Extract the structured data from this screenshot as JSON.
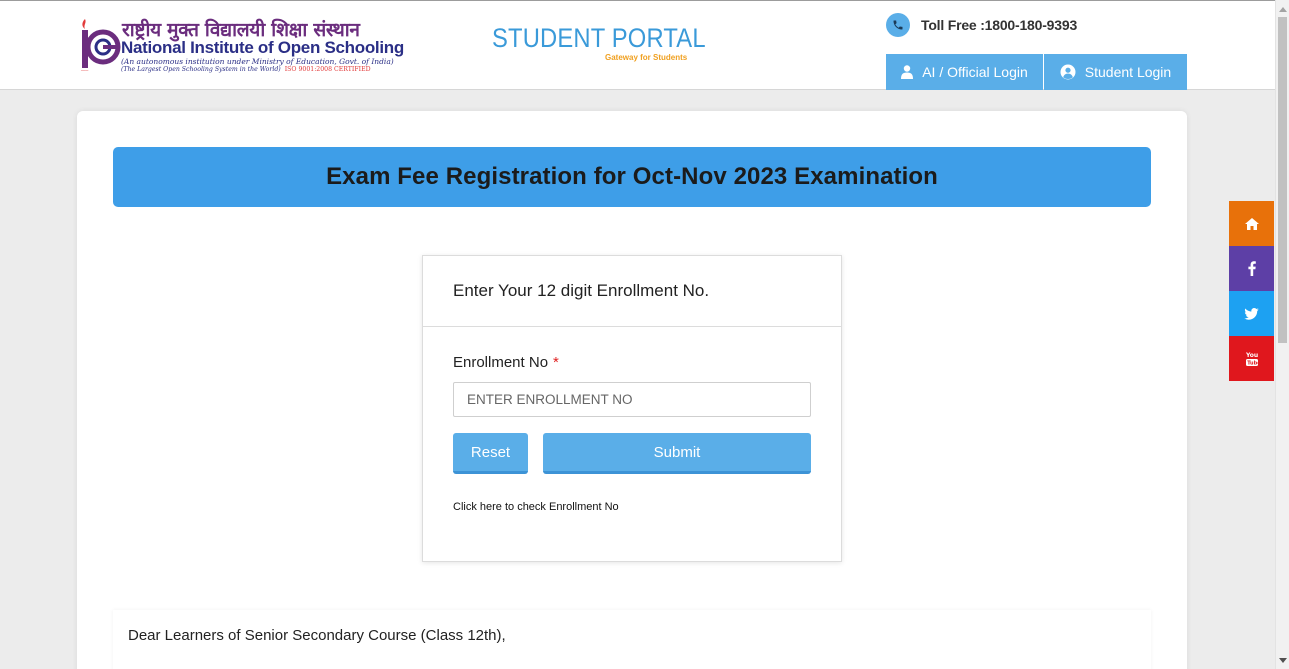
{
  "header": {
    "logo_hindi": "राष्ट्रीय मुक्त विद्यालयी शिक्षा संस्थान",
    "logo_english_part1": "National Institute of ",
    "logo_english_part2": "Open Schooling",
    "logo_sub1": "(An autonomous institution under Ministry of Education, Govt. of India)",
    "logo_sub2": "(The Largest Open Schooling System in the World)",
    "logo_iso": "ISO 9001:2008 CERTIFIED",
    "portal_title": "STUDENT PORTAL",
    "portal_subtitle": "Gateway for Students",
    "toll_free": "Toll Free :1800-180-9393",
    "login_ai": "AI / Official Login",
    "login_student": "Student Login"
  },
  "banner": {
    "title": "Exam Fee Registration for Oct-Nov 2023 Examination"
  },
  "form": {
    "heading": "Enter Your 12 digit Enrollment No.",
    "field_label": "Enrollment No",
    "required_mark": "*",
    "placeholder": "ENTER ENROLLMENT NO",
    "reset_label": "Reset",
    "submit_label": "Submit",
    "check_link": "Click here to check Enrollment No"
  },
  "notice": {
    "text": "Dear Learners of Senior Secondary Course (Class 12th),"
  },
  "social": {
    "icons": [
      "home-icon",
      "facebook-icon",
      "twitter-icon",
      "youtube-icon"
    ],
    "colors": [
      "#e8710a",
      "#5d3fa6",
      "#1da1f2",
      "#e0171d"
    ]
  },
  "colors": {
    "accent": "#3e9ee8",
    "button": "#5aaee8",
    "brand_purple": "#6b2d7e",
    "brand_blue": "#2b2f86"
  }
}
